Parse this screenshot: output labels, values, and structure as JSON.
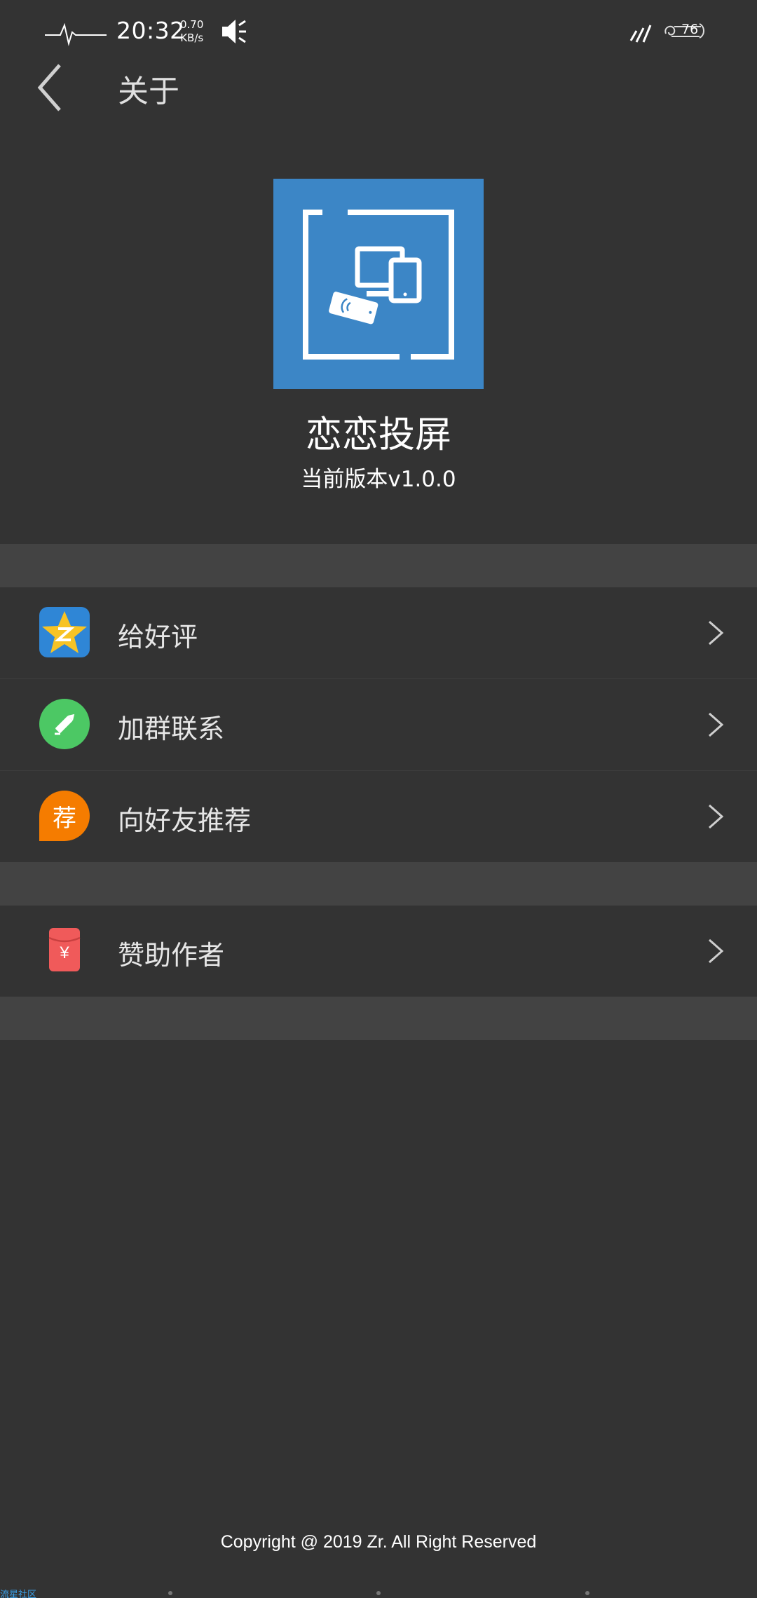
{
  "status_bar": {
    "time": "20:32",
    "speed_value": "0.70",
    "speed_unit": "KB/s",
    "battery": "76",
    "icons": [
      "pulse-icon",
      "mute-icon",
      "signal-icon",
      "battery-icon"
    ]
  },
  "header": {
    "title": "关于",
    "back_icon": "chevron-left-icon"
  },
  "app": {
    "name": "恋恋投屏",
    "version": "当前版本v1.0.0",
    "logo_icon": "screen-cast-icon",
    "logo_color": "#3c86c6"
  },
  "menu": {
    "group1": [
      {
        "label": "给好评",
        "icon": "star-rating-icon",
        "icon_color": "#2f86d6"
      },
      {
        "label": "加群联系",
        "icon": "pencil-icon",
        "icon_color": "#4cc864"
      },
      {
        "label": "向好友推荐",
        "icon": "recommend-icon",
        "icon_text": "荐",
        "icon_color": "#f57c00"
      }
    ],
    "group2": [
      {
        "label": "赞助作者",
        "icon": "red-envelope-icon",
        "icon_text": "¥",
        "icon_color": "#f05a5a"
      }
    ],
    "chevron_icon": "chevron-right-icon"
  },
  "footer": {
    "copyright": "Copyright @ 2019 Zr. All Right Reserved",
    "watermark": "流星社区"
  }
}
